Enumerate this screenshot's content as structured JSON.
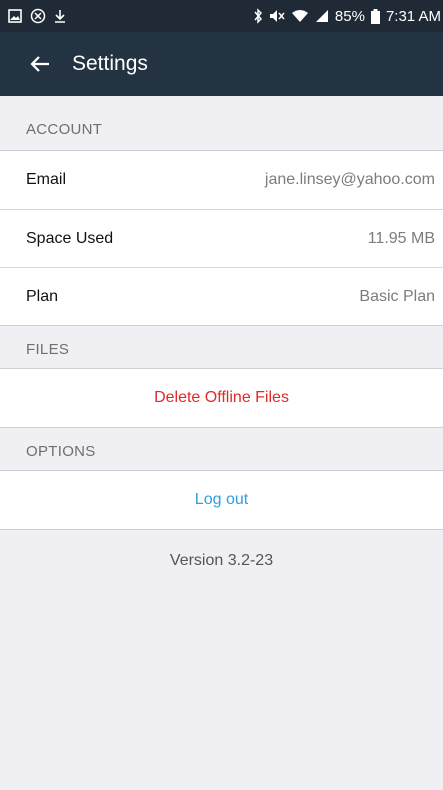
{
  "status_bar": {
    "battery_percent": "85%",
    "time": "7:31 AM"
  },
  "app_bar": {
    "title": "Settings"
  },
  "sections": {
    "account": {
      "header": "ACCOUNT",
      "rows": [
        {
          "label": "Email",
          "value": "jane.linsey@yahoo.com"
        },
        {
          "label": "Space Used",
          "value": "11.95 MB"
        },
        {
          "label": "Plan",
          "value": "Basic Plan"
        }
      ]
    },
    "files": {
      "header": "FILES",
      "action": "Delete Offline Files"
    },
    "options": {
      "header": "OPTIONS",
      "action": "Log out"
    }
  },
  "version": "Version 3.2-23",
  "colors": {
    "status_bar": "#1f2a36",
    "app_bar": "#243342",
    "background": "#efeff4",
    "destructive": "#e02a2a",
    "link": "#2f9fe0"
  },
  "icons": {
    "status_left": [
      "gallery-icon",
      "blocked-icon",
      "download-icon"
    ],
    "status_right": [
      "bluetooth-icon",
      "mute-icon",
      "wifi-icon",
      "signal-icon",
      "battery-icon"
    ],
    "back": "arrow-left-icon"
  }
}
